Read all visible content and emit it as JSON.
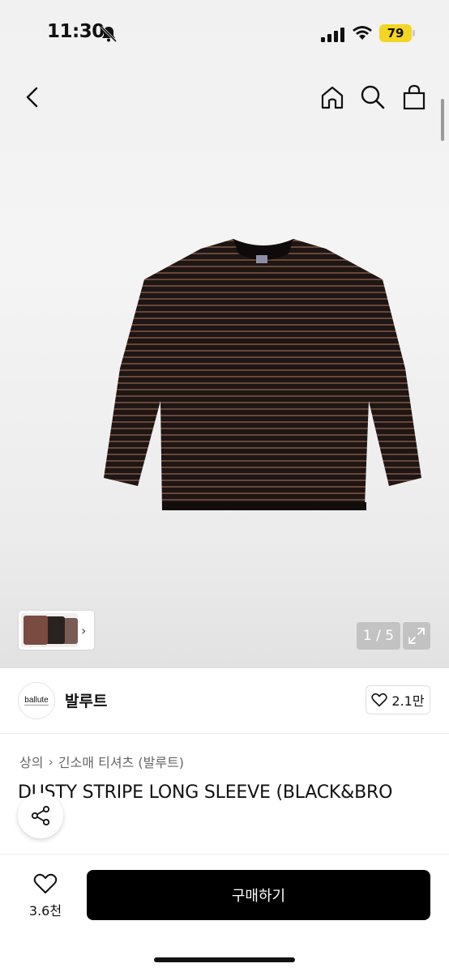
{
  "status_bar": {
    "time": "11:30",
    "battery": "79",
    "battery_color": "#f5d524"
  },
  "nav": {
    "back_icon": "chevron-left-icon",
    "home_icon": "home-icon",
    "search_icon": "search-icon",
    "bag_icon": "shopping-bag-icon"
  },
  "gallery": {
    "counter": "1 / 5",
    "thumbnail_arrow": "›"
  },
  "brand": {
    "logo_text": "ballute",
    "name": "발루트",
    "like_count": "2.1만"
  },
  "breadcrumb": {
    "items": [
      "상의",
      "긴소매 티셔츠 (발루트)"
    ],
    "separator": "›"
  },
  "product": {
    "title": "DUSTY STRIPE LONG SLEEVE (BLACK&BRO"
  },
  "bottom_bar": {
    "wish_count": "3.6천",
    "buy_label": "구매하기",
    "buy_color": "#000000"
  }
}
